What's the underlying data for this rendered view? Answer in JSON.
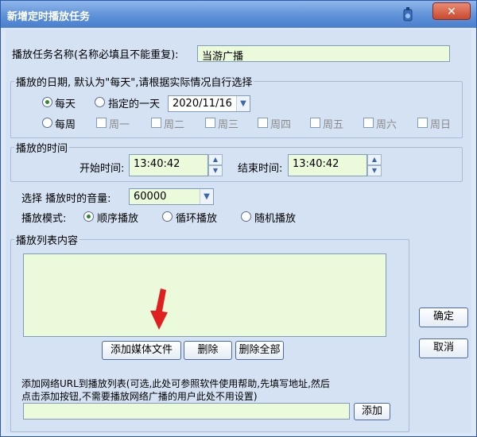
{
  "window": {
    "title": "新增定时播放任务",
    "close_label": "✕"
  },
  "task_name": {
    "label": "播放任务名称(名称必填且不能重复):",
    "value": "当游广播"
  },
  "date_group": {
    "legend": "播放的日期, 默认为\"每天\",请根据实际情况自行选择",
    "daily_label": "每天",
    "specific_label": "指定的一天",
    "date_value": "2020/11/16",
    "weekly_label": "每周",
    "weekdays": [
      "周一",
      "周二",
      "周三",
      "周四",
      "周五",
      "周六",
      "周日"
    ]
  },
  "time_group": {
    "legend": "播放的时间",
    "start_label": "开始时间:",
    "start_value": "13:40:42",
    "end_label": "结束时间:",
    "end_value": "13:40:42"
  },
  "volume": {
    "label": "选择 播放时的音量:",
    "value": "60000"
  },
  "mode": {
    "label": "播放模式:",
    "options": [
      "顺序播放",
      "循环播放",
      "随机播放"
    ]
  },
  "playlist": {
    "legend": "播放列表内容",
    "add_media_label": "添加媒体文件",
    "delete_label": "删除",
    "delete_all_label": "删除全部",
    "url_hint_1": "添加网络URL到播放列表(可选,此处可参照软件使用帮助,先填写地址,然后",
    "url_hint_2": "点击添加按钮,不需要播放网络广播的用户此处不用设置)",
    "url_value": "",
    "add_label": "添加"
  },
  "actions": {
    "ok_label": "确定",
    "cancel_label": "取消"
  },
  "colors": {
    "title_bar": "#5b8fd6",
    "panel": "#d5e2f3",
    "field": "#eafadb",
    "arrow": "#e02020"
  }
}
